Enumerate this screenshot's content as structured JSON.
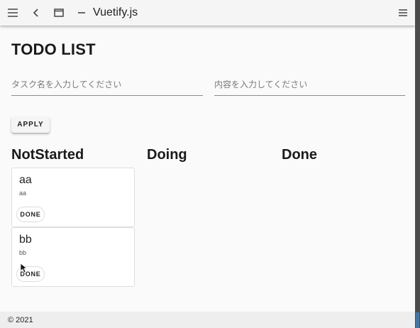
{
  "appbar": {
    "title": "Vuetify.js",
    "icons": [
      "menu-icon",
      "back-icon",
      "window-icon",
      "minimize-icon",
      "menu-icon"
    ]
  },
  "page": {
    "title": "TODO LIST",
    "task_name_placeholder": "タスク名を入力してください",
    "content_placeholder": "内容を入力してください",
    "apply_label": "APPLY"
  },
  "columns": [
    "NotStarted",
    "Doing",
    "Done"
  ],
  "cards": [
    {
      "title": "aa",
      "body": "aa",
      "button": "DONE"
    },
    {
      "title": "bb",
      "body": "bb",
      "button": "DONE"
    }
  ],
  "footer": {
    "text": "© 2021"
  },
  "colors": {
    "background": "#fafafa",
    "appbar": "#f5f5f5",
    "footer": "#eeeeee"
  }
}
